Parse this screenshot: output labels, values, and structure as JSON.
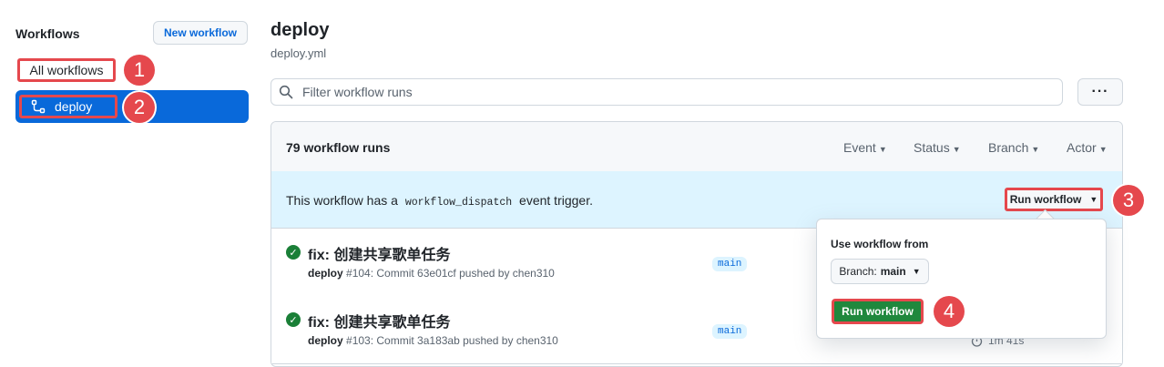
{
  "sidebar": {
    "title": "Workflows",
    "new_workflow": "New workflow",
    "all_workflows": "All workflows",
    "deploy": "deploy"
  },
  "annotations": [
    "1",
    "2",
    "3",
    "4"
  ],
  "header": {
    "title": "deploy",
    "file": "deploy.yml"
  },
  "filter": {
    "placeholder": "Filter workflow runs",
    "more": "···"
  },
  "runs": {
    "count_label": "79 workflow runs",
    "filters": [
      "Event",
      "Status",
      "Branch",
      "Actor"
    ],
    "banner_prefix": "This workflow has a",
    "banner_code": "workflow_dispatch",
    "banner_suffix": "event trigger.",
    "run_workflow": "Run workflow",
    "items": [
      {
        "title": "fix: 创建共享歌单任务",
        "workflow": "deploy",
        "number": "#104",
        "meta": ": Commit 63e01cf pushed by chen310",
        "branch": "main",
        "duration": ""
      },
      {
        "title": "fix: 创建共享歌单任务",
        "workflow": "deploy",
        "number": "#103",
        "meta": ": Commit 3a183ab pushed by chen310",
        "branch": "main",
        "duration": "1m 41s"
      }
    ]
  },
  "popup": {
    "label": "Use workflow from",
    "branch_prefix": "Branch:",
    "branch_value": "main",
    "run_button": "Run workflow"
  },
  "colors": {
    "accent": "#0969da",
    "annotation": "#e5484d",
    "success": "#1a7f37",
    "banner": "#ddf4ff"
  }
}
